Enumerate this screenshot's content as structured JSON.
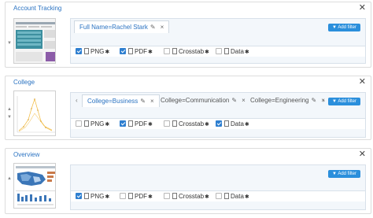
{
  "panels": [
    {
      "title": "Account Tracking",
      "tabs": [
        {
          "label": "Full Name=Rachel Stark",
          "active": true
        }
      ],
      "add_filter_label": "Add filter",
      "formats": [
        {
          "label": "PNG",
          "checked": true
        },
        {
          "label": "PDF",
          "checked": true
        },
        {
          "label": "Crosstab",
          "checked": false
        },
        {
          "label": "Data",
          "checked": false
        }
      ]
    },
    {
      "title": "College",
      "tabs": [
        {
          "label": "College=Business",
          "active": true
        },
        {
          "label": "College=Communication",
          "active": false
        },
        {
          "label": "College=Engineering",
          "active": false
        }
      ],
      "add_filter_label": "Add filter",
      "formats": [
        {
          "label": "PNG",
          "checked": false
        },
        {
          "label": "PDF",
          "checked": true
        },
        {
          "label": "Crosstab",
          "checked": false
        },
        {
          "label": "Data",
          "checked": true
        }
      ]
    },
    {
      "title": "Overview",
      "tabs": [],
      "add_filter_label": "Add filter",
      "formats": [
        {
          "label": "PNG",
          "checked": true
        },
        {
          "label": "PDF",
          "checked": false
        },
        {
          "label": "Crosstab",
          "checked": false
        },
        {
          "label": "Data",
          "checked": false
        }
      ]
    }
  ],
  "glyphs": {
    "close": "✕",
    "tab_close": "×",
    "pencil": "✎",
    "left": "‹",
    "right": "›",
    "up": "▲",
    "down": "▼",
    "gear": "✱"
  },
  "colors": {
    "accent": "#2b73c2",
    "button": "#2b8fdc",
    "check": "#2f7fd0"
  }
}
